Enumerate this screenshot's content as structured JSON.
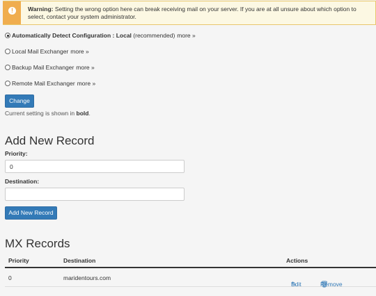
{
  "alert": {
    "icon": "warning-icon",
    "label": "Warning:",
    "message": "Setting the wrong option here can break receiving mail on your server. If you are at all unsure about which option to select, contact your system administrator."
  },
  "options": [
    {
      "label": "Automatically Detect Configuration : Local",
      "suffix": "(recommended)",
      "more": "more »",
      "checked": true
    },
    {
      "label": "Local Mail Exchanger",
      "more": "more »",
      "checked": false
    },
    {
      "label": "Backup Mail Exchanger",
      "more": "more »",
      "checked": false
    },
    {
      "label": "Remote Mail Exchanger",
      "more": "more »",
      "checked": false
    }
  ],
  "change_button": "Change",
  "note": {
    "prefix": "Current setting is shown in",
    "bold": "bold",
    "suffix": "."
  },
  "add_record": {
    "heading": "Add New Record",
    "priority_label": "Priority:",
    "priority_value": "0",
    "destination_label": "Destination:",
    "destination_value": "",
    "button": "Add New Record"
  },
  "mx_records": {
    "heading": "MX Records",
    "columns": [
      "Priority",
      "Destination",
      "Actions"
    ],
    "rows": [
      {
        "priority": "0",
        "destination": "maridentours.com",
        "edit": "Edit",
        "remove": "Remove"
      }
    ]
  },
  "colors": {
    "primary": "#337ab7",
    "warning": "#f0ad4e",
    "alert_bg": "#fcf8e3"
  }
}
